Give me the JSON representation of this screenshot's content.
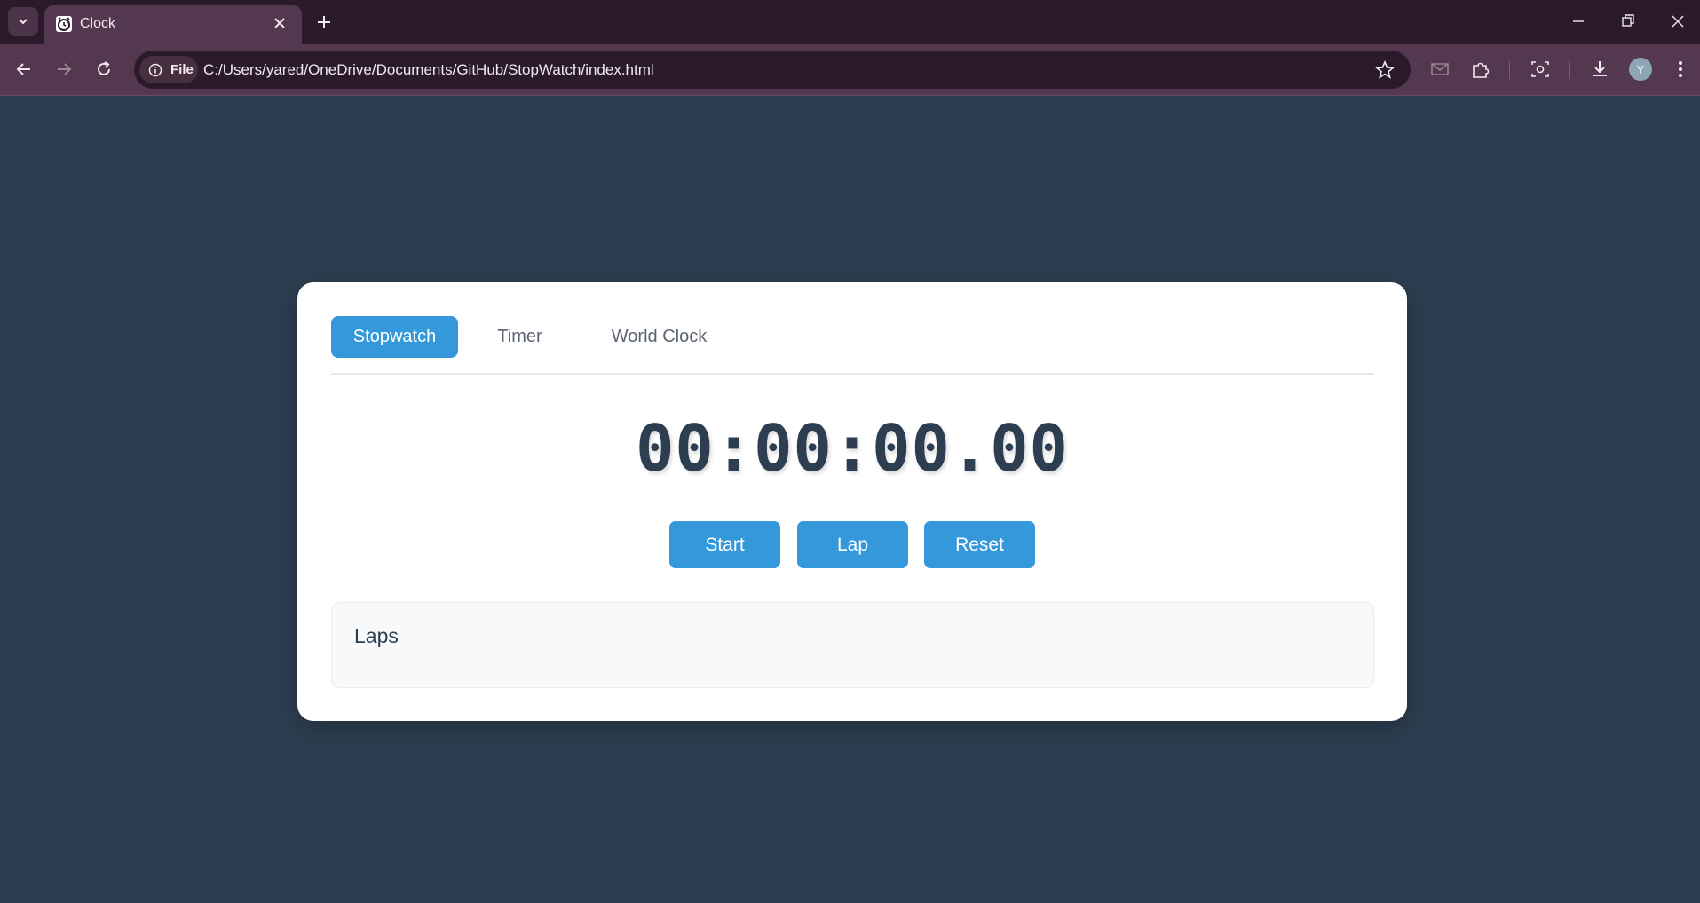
{
  "browser": {
    "tab_title": "Clock",
    "site_chip_label": "File",
    "url": "C:/Users/yared/OneDrive/Documents/GitHub/StopWatch/index.html",
    "profile_initial": "Y"
  },
  "app": {
    "tabs": [
      {
        "label": "Stopwatch",
        "active": true
      },
      {
        "label": "Timer",
        "active": false
      },
      {
        "label": "World Clock",
        "active": false
      }
    ],
    "time_display": "00:00:00.00",
    "buttons": {
      "start": "Start",
      "lap": "Lap",
      "reset": "Reset"
    },
    "laps": {
      "title": "Laps",
      "items": []
    }
  },
  "colors": {
    "page_background": "#2c3e50",
    "accent": "#3498db",
    "card_background": "#ffffff",
    "browser_frame": "#54384f"
  }
}
